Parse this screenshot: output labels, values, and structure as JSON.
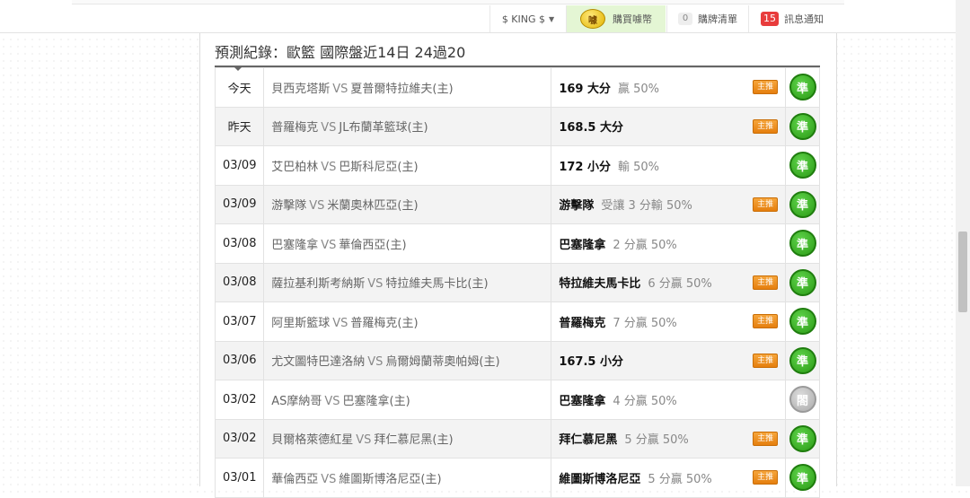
{
  "nav": {
    "user_label": "$ KING $",
    "buy_label": "購買噱幣",
    "buy_coin_glyph": "噱",
    "cart_count": "0",
    "cart_label": "購牌清單",
    "msg_count": "15",
    "msg_label": "訊息通知"
  },
  "section": {
    "title": "預測紀錄：歐籃 國際盤近14日 24過20"
  },
  "tag_label": "主推",
  "rows": [
    {
      "date": "今天",
      "away": "貝西克塔斯",
      "vs": "VS",
      "home": "夏普爾特拉維夫(主)",
      "pick": "169 大分",
      "detail": "贏 50%",
      "tag": true,
      "result": "準",
      "result_type": "win"
    },
    {
      "date": "昨天",
      "away": "普羅梅克",
      "vs": "VS",
      "home": "JL布蘭革籃球(主)",
      "pick": "168.5 大分",
      "detail": "",
      "tag": true,
      "result": "準",
      "result_type": "win"
    },
    {
      "date": "03/09",
      "away": "艾巴柏林",
      "vs": "VS",
      "home": "巴斯科尼亞(主)",
      "pick": "172 小分",
      "detail": "輸 50%",
      "tag": false,
      "result": "準",
      "result_type": "win"
    },
    {
      "date": "03/09",
      "away": "游擊隊",
      "vs": "VS",
      "home": "米蘭奧林匹亞(主)",
      "pick": "游擊隊",
      "detail": "受讓 3 分輸 50%",
      "tag": true,
      "result": "準",
      "result_type": "win"
    },
    {
      "date": "03/08",
      "away": "巴塞隆拿",
      "vs": "VS",
      "home": "華倫西亞(主)",
      "pick": "巴塞隆拿",
      "detail": "2 分贏 50%",
      "tag": false,
      "result": "準",
      "result_type": "win"
    },
    {
      "date": "03/08",
      "away": "薩拉基利斯考納斯",
      "vs": "VS",
      "home": "特拉維夫馬卡比(主)",
      "pick": "特拉維夫馬卡比",
      "detail": "6 分贏 50%",
      "tag": true,
      "result": "準",
      "result_type": "win"
    },
    {
      "date": "03/07",
      "away": "阿里斯籃球",
      "vs": "VS",
      "home": "普羅梅克(主)",
      "pick": "普羅梅克",
      "detail": "7 分贏 50%",
      "tag": true,
      "result": "準",
      "result_type": "win"
    },
    {
      "date": "03/06",
      "away": "尤文圖特巴達洛納",
      "vs": "VS",
      "home": "烏爾姆蘭蒂奧帕姆(主)",
      "pick": "167.5 小分",
      "detail": "",
      "tag": true,
      "result": "準",
      "result_type": "win"
    },
    {
      "date": "03/02",
      "away": "AS摩納哥",
      "vs": "VS",
      "home": "巴塞隆拿(主)",
      "pick": "巴塞隆拿",
      "detail": "4 分贏 50%",
      "tag": false,
      "result": "閤",
      "result_type": "push"
    },
    {
      "date": "03/02",
      "away": "貝爾格萊德紅星",
      "vs": "VS",
      "home": "拜仁慕尼黑(主)",
      "pick": "拜仁慕尼黑",
      "detail": "5 分贏 50%",
      "tag": true,
      "result": "準",
      "result_type": "win"
    },
    {
      "date": "03/01",
      "away": "華倫西亞",
      "vs": "VS",
      "home": "維圖斯博洛尼亞(主)",
      "pick": "維圖斯博洛尼亞",
      "detail": "5 分贏 50%",
      "tag": true,
      "result": "準",
      "result_type": "win"
    }
  ]
}
